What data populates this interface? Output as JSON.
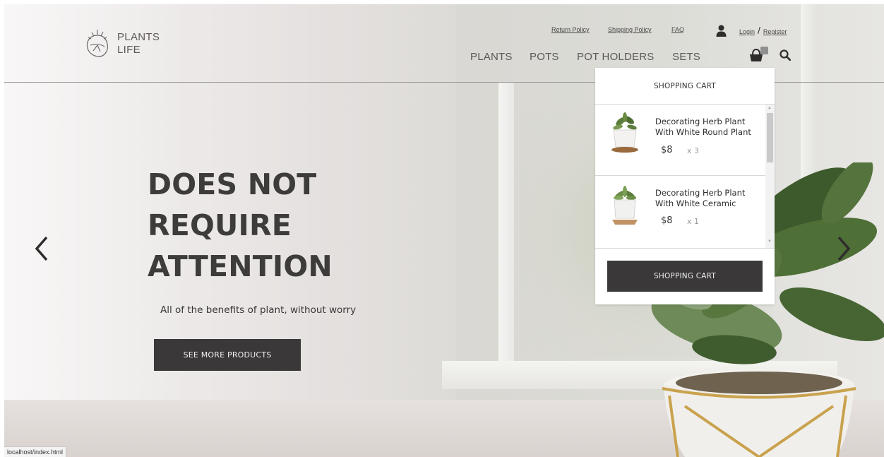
{
  "brand": {
    "logo_line1": "PLANTS",
    "logo_line2": "LIFE"
  },
  "utility_links": [
    "Return Policy",
    "Shipping Policy",
    "FAQ"
  ],
  "auth": {
    "login": "Login",
    "separator": "/",
    "register": "Register"
  },
  "nav": [
    "PLANTS",
    "POTS",
    "POT HOLDERS",
    "SETS"
  ],
  "icons": {
    "user": "user-icon",
    "cart": "cart-icon",
    "search": "search-icon",
    "prev": "chevron-left-icon",
    "next": "chevron-right-icon"
  },
  "hero": {
    "headline": [
      "DOES NOT",
      "REQUIRE",
      "ATTENTION"
    ],
    "subline": "All of the benefits of plant, without worry",
    "cta": "SEE MORE PRODUCTS"
  },
  "cart": {
    "title": "SHOPPING CART",
    "items": [
      {
        "name": "Decorating Herb Plant With White Round Plant",
        "price": "$8",
        "qty": "x 3"
      },
      {
        "name": "Decorating Herb Plant With White Ceramic",
        "price": "$8",
        "qty": "x 1"
      }
    ],
    "button": "SHOPPING CART"
  },
  "status_bar": {
    "url": "localhost/index.html"
  },
  "colors": {
    "dark_button": "#3a3838",
    "text_dark": "#3e3b3b",
    "nav_text": "#5a5858"
  }
}
